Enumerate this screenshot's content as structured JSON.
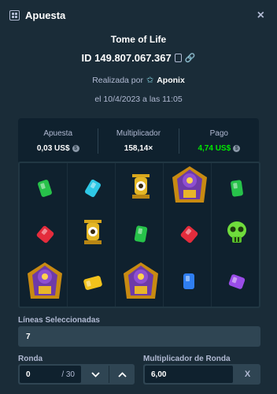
{
  "header": {
    "title": "Apuesta",
    "close_symbol": "×"
  },
  "bet": {
    "game": "Tome of Life",
    "id": "ID 149.807.067.367",
    "placed_by_label": "Realizada por",
    "user": "Aponix",
    "date": "el 10/4/2023 a las 11:05"
  },
  "stats": {
    "bet_label": "Apuesta",
    "bet_value": "0,03 US$",
    "mult_label": "Multiplicador",
    "mult_value": "158,14×",
    "payout_label": "Pago",
    "payout_value": "4,74 US$"
  },
  "board": {
    "rows": [
      [
        "green-gem",
        "cyan-gem",
        "eye-idol",
        "golden-pharaoh",
        "green-gem"
      ],
      [
        "red-gem",
        "eye-idol",
        "green-gem",
        "red-gem",
        "green-skull"
      ],
      [
        "golden-pharaoh",
        "yellow-gem",
        "golden-pharaoh",
        "blue-gem",
        "purple-gem"
      ]
    ]
  },
  "form": {
    "lines_label": "Líneas Seleccionadas",
    "lines_value": "7",
    "round_label": "Ronda",
    "round_value": "0",
    "round_total": "/ 30",
    "round_mult_label": "Multiplicador de Ronda",
    "round_mult_value": "6,00",
    "clear_symbol": "X"
  },
  "colors": {
    "payout_green": "#00e701",
    "panel": "#0f212e",
    "background": "#1a2c38"
  }
}
